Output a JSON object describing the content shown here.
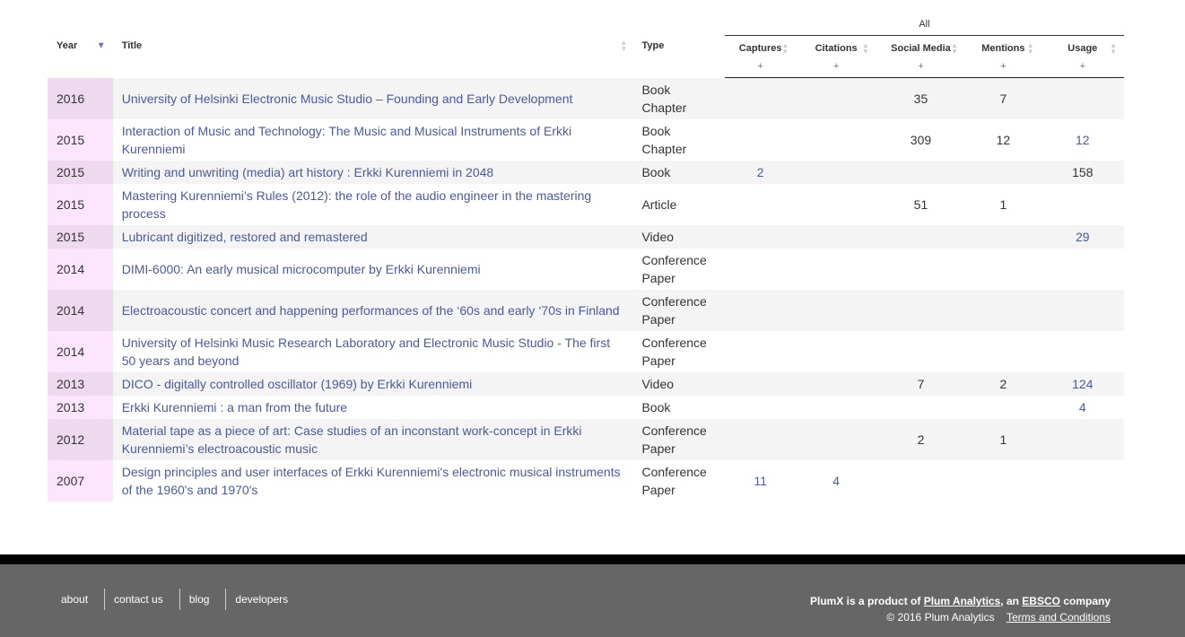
{
  "table": {
    "group_header": "All",
    "headers": {
      "year": "Year",
      "title": "Title",
      "type": "Type",
      "captures": "Captures",
      "citations": "Citations",
      "social": "Social Media",
      "mentions": "Mentions",
      "usage": "Usage"
    },
    "plus": "+",
    "rows": [
      {
        "year": "2016",
        "title": "University of Helsinki Electronic Music Studio – Founding and Early Development",
        "type": "Book Chapter",
        "captures": "",
        "citations": "",
        "social": "35",
        "mentions": "7",
        "usage": ""
      },
      {
        "year": "2015",
        "title": "Interaction of Music and Technology: The Music and Musical Instruments of Erkki Kurenniemi",
        "type": "Book Chapter",
        "captures": "",
        "citations": "",
        "social": "309",
        "mentions": "12",
        "usage": "12"
      },
      {
        "year": "2015",
        "title": "Writing and unwriting (media) art history : Erkki Kurenniemi in 2048",
        "type": "Book",
        "captures": "2",
        "citations": "",
        "social": "",
        "mentions": "",
        "usage": "158"
      },
      {
        "year": "2015",
        "title": "Mastering Kurenniemi’s Rules (2012): the role of the audio engineer in the mastering process",
        "type": "Article",
        "captures": "",
        "citations": "",
        "social": "51",
        "mentions": "1",
        "usage": ""
      },
      {
        "year": "2015",
        "title": "Lubricant digitized, restored and remastered",
        "type": "Video",
        "captures": "",
        "citations": "",
        "social": "",
        "mentions": "",
        "usage": "29"
      },
      {
        "year": "2014",
        "title": "DIMI-6000: An early musical microcomputer by Erkki Kurenniemi",
        "type": "Conference Paper",
        "captures": "",
        "citations": "",
        "social": "",
        "mentions": "",
        "usage": ""
      },
      {
        "year": "2014",
        "title": "Electroacoustic concert and happening performances of the ‘60s and early ‘70s in Finland",
        "type": "Conference Paper",
        "captures": "",
        "citations": "",
        "social": "",
        "mentions": "",
        "usage": ""
      },
      {
        "year": "2014",
        "title": "University of Helsinki Music Research Laboratory and Electronic Music Studio - The first 50 years and beyond",
        "type": "Conference Paper",
        "captures": "",
        "citations": "",
        "social": "",
        "mentions": "",
        "usage": ""
      },
      {
        "year": "2013",
        "title": "DICO - digitally controlled oscillator (1969) by Erkki Kurenniemi",
        "type": "Video",
        "captures": "",
        "citations": "",
        "social": "7",
        "mentions": "2",
        "usage": "124"
      },
      {
        "year": "2013",
        "title": "Erkki Kurenniemi : a man from the future",
        "type": "Book",
        "captures": "",
        "citations": "",
        "social": "",
        "mentions": "",
        "usage": "4"
      },
      {
        "year": "2012",
        "title": "Material tape as a piece of art: Case studies of an inconstant work-concept in Erkki Kurenniemi’s electroacoustic music",
        "type": "Conference Paper",
        "captures": "",
        "citations": "",
        "social": "2",
        "mentions": "1",
        "usage": ""
      },
      {
        "year": "2007",
        "title": "Design principles and user interfaces of Erkki Kurenniemi's electronic musical instruments of the 1960's and 1970's",
        "type": "Conference Paper",
        "captures": "11",
        "citations": "4",
        "social": "",
        "mentions": "",
        "usage": ""
      }
    ]
  },
  "footer": {
    "links": [
      "about",
      "contact us",
      "blog",
      "developers"
    ],
    "product_prefix": "PlumX is a product of ",
    "plum": "Plum Analytics",
    "mid": ", an ",
    "ebsco": "EBSCO",
    "suffix": " company",
    "copyright": "© 2016 Plum Analytics",
    "terms": "Terms and Conditions"
  },
  "colors": {
    "link": "#4b5a9a",
    "footer_bg": "#666666",
    "year_pink_a": "#efd9ef",
    "year_pink_b": "#fde6fd"
  }
}
